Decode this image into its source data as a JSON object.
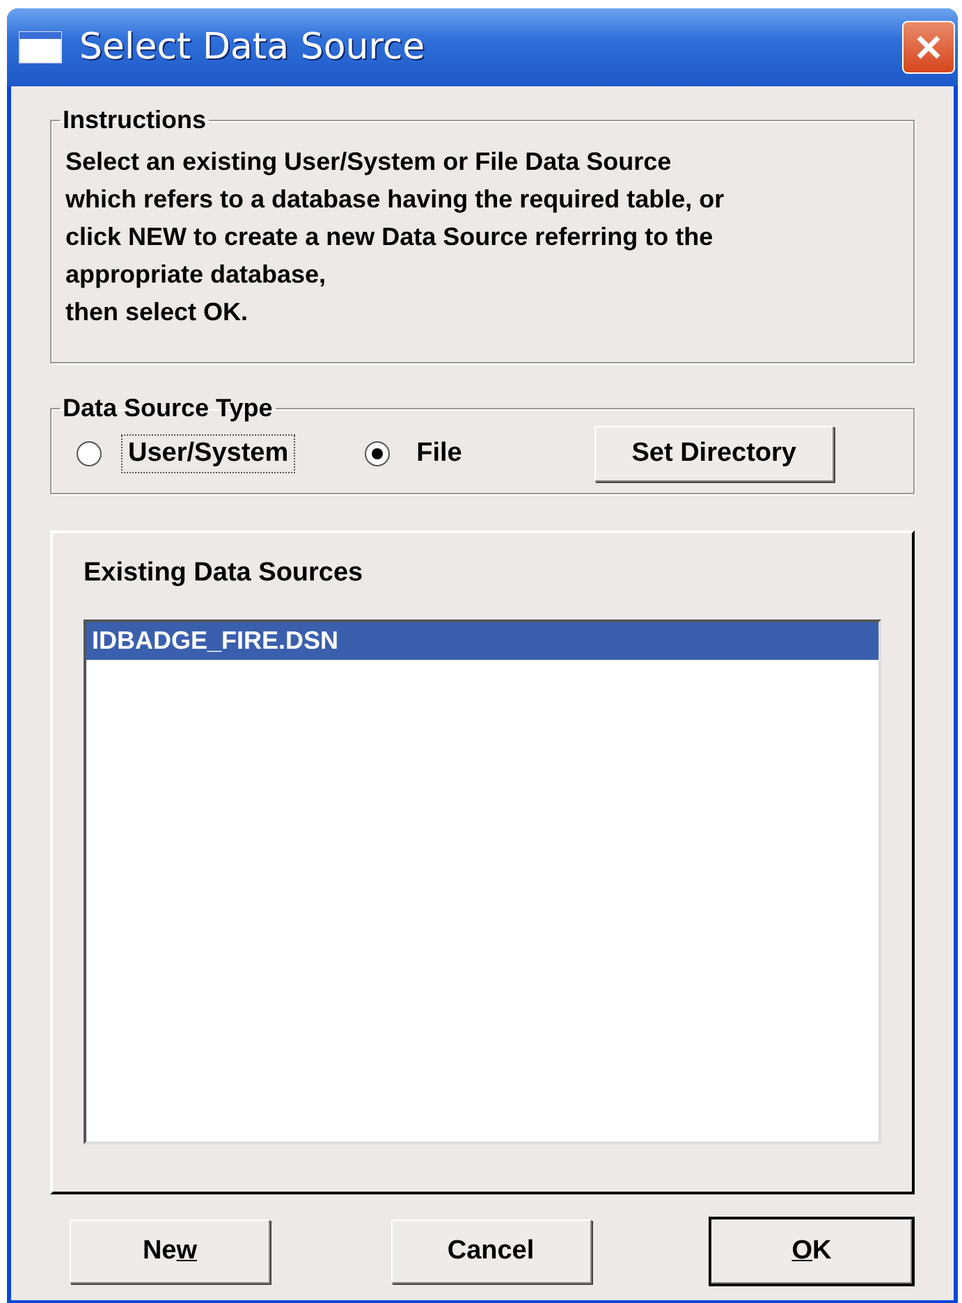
{
  "window": {
    "title": "Select Data Source"
  },
  "instructions": {
    "legend": "Instructions",
    "lines": [
      "Select an existing User/System or File Data Source",
      "which refers to a database having the required table, or",
      "click NEW to create a new Data Source referring to the",
      "appropriate database,",
      "then select OK."
    ]
  },
  "data_source_type": {
    "legend": "Data Source Type",
    "options": [
      {
        "label": "User/System",
        "selected": false,
        "focused": true
      },
      {
        "label": "File",
        "selected": true,
        "focused": false
      }
    ],
    "button": "Set Directory"
  },
  "existing": {
    "heading": "Existing Data Sources",
    "items": [
      {
        "label": "IDBADGE_FIRE.DSN",
        "selected": true
      }
    ]
  },
  "buttons": [
    {
      "label_parts": [
        {
          "text": "Ne",
          "underline": false
        },
        {
          "text": "w",
          "underline": true
        }
      ],
      "default": false
    },
    {
      "label_parts": [
        {
          "text": "Cancel",
          "underline": false
        }
      ],
      "default": false
    },
    {
      "label_parts": [
        {
          "text": "O",
          "underline": true
        },
        {
          "text": "K",
          "underline": false
        }
      ],
      "default": true
    }
  ]
}
